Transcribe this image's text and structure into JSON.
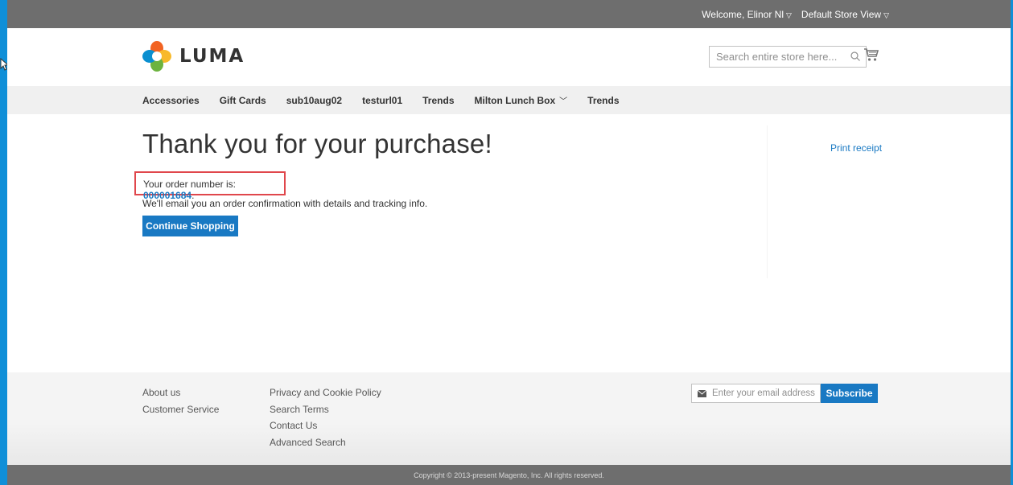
{
  "topbar": {
    "welcome": "Welcome, Elinor Nl",
    "store_view": "Default Store View"
  },
  "header": {
    "logo_text": "LUMA",
    "search_placeholder": "Search entire store here...",
    "icons": {
      "search": "search-icon",
      "cart": "cart-icon"
    }
  },
  "nav": {
    "items": [
      {
        "label": "Accessories",
        "has_caret": false
      },
      {
        "label": "Gift Cards",
        "has_caret": false
      },
      {
        "label": "sub10aug02",
        "has_caret": false
      },
      {
        "label": "testurl01",
        "has_caret": false
      },
      {
        "label": "Trends",
        "has_caret": false
      },
      {
        "label": "Milton Lunch Box",
        "has_caret": true
      },
      {
        "label": "Trends",
        "has_caret": false
      }
    ]
  },
  "main": {
    "title": "Thank you for your purchase!",
    "print_receipt": "Print receipt",
    "order_prefix": "Your order number is: ",
    "order_number": "000001684",
    "order_suffix": ".",
    "email_note": "We'll email you an order confirmation with details and tracking info.",
    "continue_label": "Continue Shopping"
  },
  "footer": {
    "col1": [
      "About us",
      "Customer Service"
    ],
    "col2": [
      "Privacy and Cookie Policy",
      "Search Terms",
      "Contact Us",
      "Advanced Search"
    ],
    "newsletter_placeholder": "Enter your email address",
    "subscribe_label": "Subscribe",
    "copyright": "Copyright © 2013-present Magento, Inc. All rights reserved."
  },
  "colors": {
    "accent": "#1979c3",
    "highlight_border": "#e0474c",
    "topbar_bg": "#6e6e6e",
    "nav_bg": "#f0f0f0"
  }
}
